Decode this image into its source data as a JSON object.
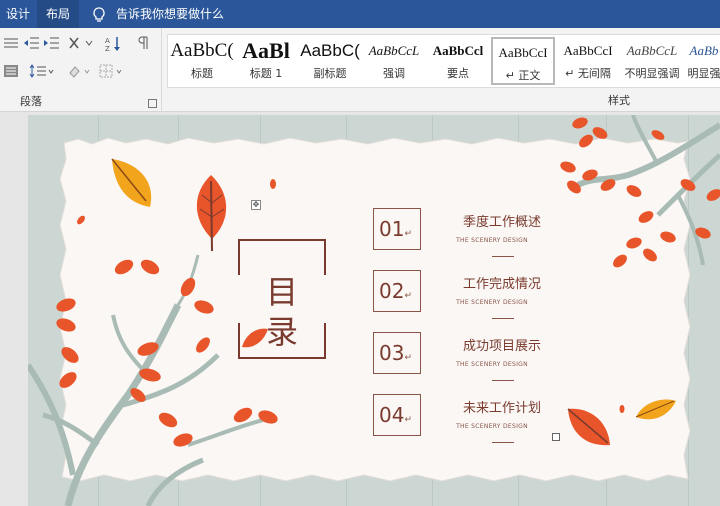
{
  "menubar": {
    "tabs": [
      "设计",
      "布局"
    ],
    "tell_me": "告诉我你想要做什么"
  },
  "ribbon": {
    "paragraph_group_label": "段落",
    "styles_group_label": "样式",
    "styles": [
      {
        "sample": "AaBbC(",
        "name": "标题"
      },
      {
        "sample": "AaBl",
        "name": "标题 1"
      },
      {
        "sample": "AaBbC(",
        "name": "副标题"
      },
      {
        "sample": "AaBbCcL",
        "name": "强调"
      },
      {
        "sample": "AaBbCcl",
        "name": "要点"
      },
      {
        "sample": "AaBbCcI",
        "name": "↵ 正文"
      },
      {
        "sample": "AaBbCcI",
        "name": "↵ 无间隔"
      },
      {
        "sample": "AaBbCcL",
        "name": "不明显强调"
      },
      {
        "sample": "AaBb",
        "name": "明显强"
      }
    ],
    "selected_style": "↵ 正文"
  },
  "slide": {
    "title_chars": [
      "目",
      "录"
    ],
    "items": [
      {
        "num": "01",
        "title": "季度工作概述",
        "sub": "THE SCENERY DESIGN"
      },
      {
        "num": "02",
        "title": "工作完成情况",
        "sub": "THE SCENERY DESIGN"
      },
      {
        "num": "03",
        "title": "成功项目展示",
        "sub": "THE SCENERY DESIGN"
      },
      {
        "num": "04",
        "title": "未来工作计划",
        "sub": "THE SCENERY DESIGN"
      }
    ],
    "para_mark": "↵"
  },
  "colors": {
    "ribbon_blue": "#2b579a",
    "leaf_orange": "#e8552a",
    "leaf_yellow": "#f2a41c",
    "branch": "#a9bbb5",
    "text_brown": "#7a3b2e"
  }
}
